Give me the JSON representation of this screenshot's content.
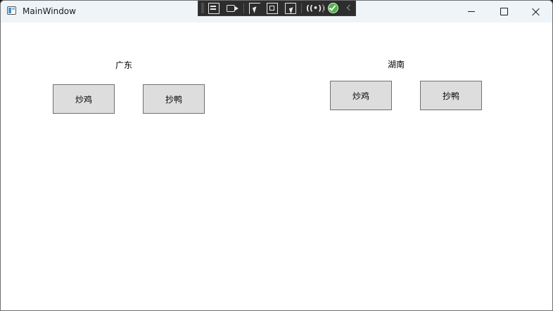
{
  "window": {
    "title": "MainWindow"
  },
  "debug_toolbar": {
    "icons": [
      "live-visual-tree-icon",
      "record-icon",
      "select-element-icon",
      "display-layout-adorners-icon",
      "track-focused-element-icon",
      "binding-failures-icon",
      "hot-reload-status-icon",
      "collapse-toolbar-icon"
    ]
  },
  "groups": [
    {
      "title": "广东",
      "buttons": [
        "炒鸡",
        "抄鸭"
      ]
    },
    {
      "title": "湖南",
      "buttons": [
        "炒鸡",
        "抄鸭"
      ]
    }
  ],
  "colors": {
    "titlebar": "#eff4f9",
    "button_face": "#dddddd",
    "button_border": "#707070",
    "toolbar_bg": "#2d2d2d",
    "hot_reload_ok": "#4fb34a"
  }
}
